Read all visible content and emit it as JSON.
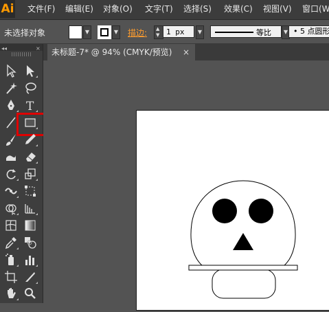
{
  "app": {
    "logo": "Ai"
  },
  "menubar": {
    "items": [
      "文件(F)",
      "编辑(E)",
      "对象(O)",
      "文字(T)",
      "选择(S)",
      "效果(C)",
      "视图(V)",
      "窗口(W)"
    ]
  },
  "controlbar": {
    "selection_status": "未选择对象",
    "stroke_label": "描边:",
    "stroke_weight": "1 px",
    "profile_label": "等比",
    "brush_label": "• 5 点圆形"
  },
  "document": {
    "tab_title": "未标题-7* @ 94% (CMYK/预览)",
    "close_glyph": "×"
  },
  "toolbox": {
    "tools": [
      "selection-tool",
      "direct-selection-tool",
      "magic-wand-tool",
      "lasso-tool",
      "pen-tool",
      "type-tool",
      "line-segment-tool",
      "rectangle-tool",
      "paintbrush-tool",
      "pencil-tool",
      "blob-brush-tool",
      "eraser-tool",
      "rotate-tool",
      "scale-tool",
      "width-tool",
      "free-transform-tool",
      "shape-builder-tool",
      "perspective-grid-tool",
      "mesh-tool",
      "gradient-tool",
      "eyedropper-tool",
      "blend-tool",
      "symbol-sprayer-tool",
      "column-graph-tool",
      "artboard-tool",
      "slice-tool",
      "hand-tool",
      "zoom-tool"
    ],
    "highlighted_tool": "rectangle-tool",
    "highlight_color": "#e00000"
  },
  "colors": {
    "menubar_bg": "#3c3c3c",
    "panel_bg": "#535353",
    "accent_orange": "#ff9d2e"
  }
}
